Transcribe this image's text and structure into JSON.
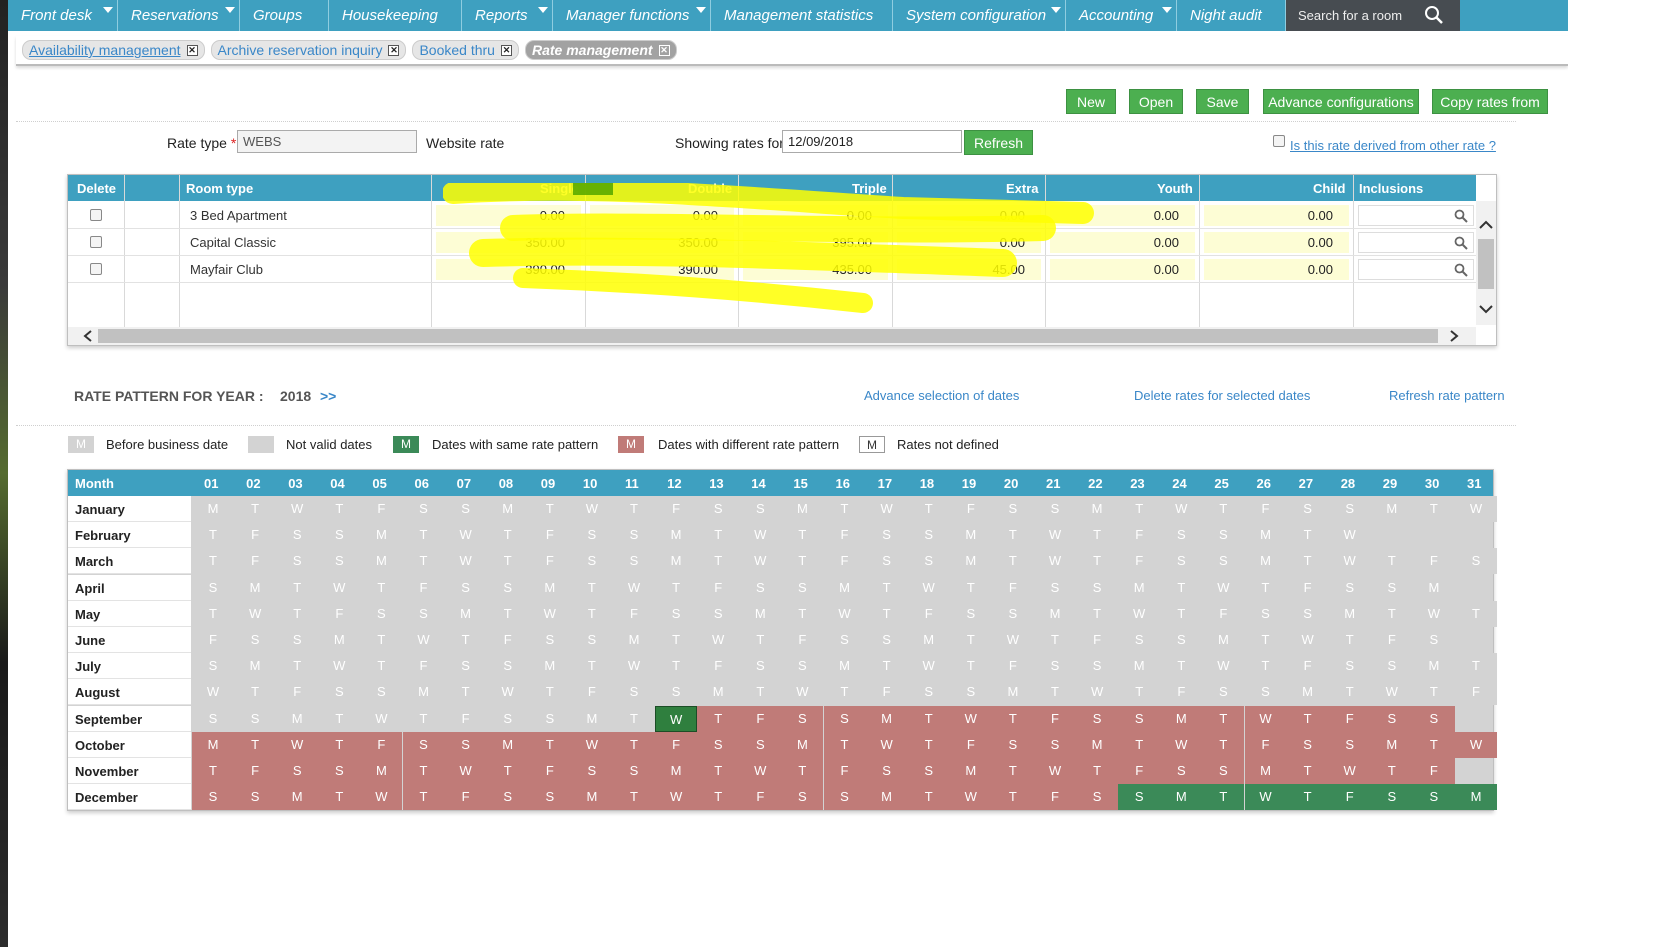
{
  "menu": {
    "items": [
      {
        "label": "Front desk",
        "caret": true
      },
      {
        "label": "Reservations",
        "caret": true
      },
      {
        "label": "Groups",
        "caret": false
      },
      {
        "label": "Housekeeping",
        "caret": false
      },
      {
        "label": "Reports",
        "caret": true
      },
      {
        "label": "Manager functions",
        "caret": true
      },
      {
        "label": "Management statistics",
        "caret": false
      },
      {
        "label": "System configuration",
        "caret": true
      },
      {
        "label": "Accounting",
        "caret": true
      },
      {
        "label": "Night audit",
        "caret": false
      }
    ],
    "search_placeholder": "Search for a room"
  },
  "tabs": [
    {
      "label": "Availability management",
      "active": false
    },
    {
      "label": "Archive reservation inquiry",
      "active": false
    },
    {
      "label": "Booked thru",
      "active": false
    },
    {
      "label": "Rate management",
      "active": true
    }
  ],
  "actions": {
    "new": "New",
    "open": "Open",
    "save": "Save",
    "advance": "Advance configurations",
    "copy": "Copy rates from"
  },
  "form": {
    "rate_type_label": "Rate type",
    "required_mark": "*",
    "rate_type_value": "WEBS",
    "rate_type_desc": "Website rate",
    "showing_label": "Showing rates for",
    "showing_date": "12/09/2018",
    "refresh": "Refresh",
    "derived_label": "Is this rate derived from other rate ?"
  },
  "rate_grid": {
    "headers": [
      "Delete",
      "Room type",
      "Single",
      "Double",
      "Triple",
      "Extra",
      "Youth",
      "Child",
      "Inclusions"
    ],
    "rows": [
      {
        "room": "3 Bed Apartment",
        "single": "0.00",
        "double": "0.00",
        "triple": "0.00",
        "extra": "0.00",
        "youth": "0.00",
        "child": "0.00"
      },
      {
        "room": "Capital Classic",
        "single": "350.00",
        "double": "350.00",
        "triple": "395.00",
        "extra": "0.00",
        "youth": "0.00",
        "child": "0.00"
      },
      {
        "room": "Mayfair Club",
        "single": "390.00",
        "double": "390.00",
        "triple": "435.00",
        "extra": "45.00",
        "youth": "0.00",
        "child": "0.00"
      }
    ]
  },
  "pattern": {
    "title": "RATE PATTERN FOR YEAR :",
    "year": "2018",
    "next": ">>",
    "advance_link": "Advance selection of dates",
    "delete_link": "Delete rates for selected dates",
    "refresh_link": "Refresh rate pattern",
    "legend": [
      {
        "key": "M",
        "label": "Before business date",
        "color": "#d3d3d3"
      },
      {
        "key": "",
        "label": "Not valid dates",
        "color": "#d3d3d3"
      },
      {
        "key": "M",
        "label": "Dates with same rate pattern",
        "color": "#3b8a58"
      },
      {
        "key": "M",
        "label": "Dates with different rate pattern",
        "color": "#c07b78"
      },
      {
        "key": "M",
        "label": "Rates not defined",
        "color": "#ffffff"
      }
    ]
  },
  "calendar": {
    "month_header": "Month",
    "days_header": [
      "01",
      "02",
      "03",
      "04",
      "05",
      "06",
      "07",
      "08",
      "09",
      "10",
      "11",
      "12",
      "13",
      "14",
      "15",
      "16",
      "17",
      "18",
      "19",
      "20",
      "21",
      "22",
      "23",
      "24",
      "25",
      "26",
      "27",
      "28",
      "29",
      "30",
      "31"
    ],
    "months": [
      {
        "name": "January",
        "days": "MTWTFSSMTWTFSSMTWTFSSMTWTFSSMTW",
        "red_from": 0,
        "red_to": 0,
        "green_from": 0,
        "green_to": 0,
        "sel": 0
      },
      {
        "name": "February",
        "days": "TFSSMTWTFSSMTWTFSSMTWTFSSMTW",
        "red_from": 0,
        "red_to": 0,
        "green_from": 0,
        "green_to": 0,
        "sel": 0
      },
      {
        "name": "March",
        "days": "TFSSMTWTFSSMTWTFSSMTWTFSSMTWTFS",
        "red_from": 0,
        "red_to": 0,
        "green_from": 0,
        "green_to": 0,
        "sel": 0
      },
      {
        "name": "April",
        "days": "SMTWTFSSMTWTFSSMTWTFSSMTWTFSSM",
        "red_from": 0,
        "red_to": 0,
        "green_from": 0,
        "green_to": 0,
        "sel": 0
      },
      {
        "name": "May",
        "days": "TWTFSSMTWTFSSMTWTFSSMTWTFSSMTWT",
        "red_from": 0,
        "red_to": 0,
        "green_from": 0,
        "green_to": 0,
        "sel": 0
      },
      {
        "name": "June",
        "days": "FSSMTWTFSSMTWTFSSMTWTFSSMTWTFS",
        "red_from": 0,
        "red_to": 0,
        "green_from": 0,
        "green_to": 0,
        "sel": 0
      },
      {
        "name": "July",
        "days": "SMTWTFSSMTWTFSSMTWTFSSMTWTFSSMT",
        "red_from": 0,
        "red_to": 0,
        "green_from": 0,
        "green_to": 0,
        "sel": 0
      },
      {
        "name": "August",
        "days": "WTFSSMTWTFSSMTWTFSSMTWTFSSMTWTF",
        "red_from": 0,
        "red_to": 0,
        "green_from": 0,
        "green_to": 0,
        "sel": 0
      },
      {
        "name": "September",
        "days": "SSMTWTFSSMTWTFSSMTWTFSSMTWTFSS",
        "red_from": 13,
        "red_to": 30,
        "green_from": 0,
        "green_to": 0,
        "sel": 12
      },
      {
        "name": "October",
        "days": "MTWTFSSMTWTFSSMTWTFSSMTWTFSSMTW",
        "red_from": 1,
        "red_to": 31,
        "green_from": 0,
        "green_to": 0,
        "sel": 0
      },
      {
        "name": "November",
        "days": "TFSSMTWTFSSMTWTFSSMTWTFSSMTWTF",
        "red_from": 1,
        "red_to": 30,
        "green_from": 0,
        "green_to": 0,
        "sel": 0
      },
      {
        "name": "December",
        "days": "SSMTWTFSSMTWTFSSMTWTFSSMTWTFSSM",
        "red_from": 1,
        "red_to": 22,
        "green_from": 23,
        "green_to": 31,
        "sel": 0
      }
    ]
  }
}
